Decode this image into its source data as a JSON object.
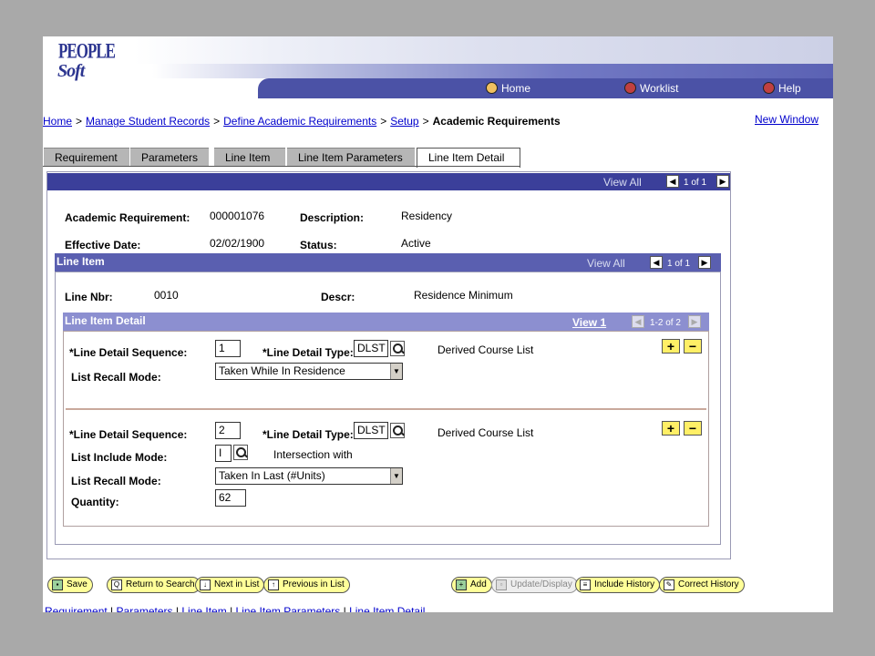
{
  "header": {
    "logo_line1": "PEOPLE",
    "logo_line2": "Soft",
    "nav": {
      "home": "Home",
      "worklist": "Worklist",
      "help": "Help"
    }
  },
  "breadcrumb": {
    "items": [
      "Home",
      "Manage Student Records",
      "Define Academic Requirements",
      "Setup"
    ],
    "separator": ">",
    "current": "Academic Requirements"
  },
  "new_window": "New Window",
  "tabs": [
    "Requirement",
    "Parameters",
    "Line Item",
    "Line Item Parameters",
    "Line Item Detail"
  ],
  "main": {
    "view_all": "View All",
    "counter": "1 of 1",
    "fields": {
      "academic_requirement_label": "Academic Requirement:",
      "academic_requirement_value": "000001076",
      "description_label": "Description:",
      "description_value": "Residency",
      "effective_date_label": "Effective Date:",
      "effective_date_value": "02/02/1900",
      "status_label": "Status:",
      "status_value": "Active"
    }
  },
  "line_item": {
    "title": "Line Item",
    "view_all": "View All",
    "counter": "1 of 1",
    "line_nbr_label": "Line Nbr:",
    "line_nbr_value": "0010",
    "descr_label": "Descr:",
    "descr_value": "Residence Minimum"
  },
  "line_item_detail": {
    "title": "Line Item Detail",
    "view_link": "View 1",
    "counter": "1-2 of 2",
    "rows": [
      {
        "seq_label": "*Line Detail Sequence:",
        "seq_value": "1",
        "type_label": "*Line Detail Type:",
        "type_value": "DLST",
        "type_desc": "Derived Course List",
        "recall_label": "List Recall Mode:",
        "recall_value": "Taken While In Residence"
      },
      {
        "seq_label": "*Line Detail Sequence:",
        "seq_value": "2",
        "type_label": "*Line Detail Type:",
        "type_value": "DLST",
        "type_desc": "Derived Course List",
        "include_label": "List Include Mode:",
        "include_value": "I",
        "include_desc": "Intersection with",
        "recall_label": "List Recall Mode:",
        "recall_value": "Taken In Last (#Units)",
        "quantity_label": "Quantity:",
        "quantity_value": "62"
      }
    ],
    "add_symbol": "+",
    "remove_symbol": "−"
  },
  "toolbar": {
    "save": "Save",
    "return_to_search": "Return to Search",
    "next_in_list": "Next in List",
    "previous_in_list": "Previous in List",
    "add": "Add",
    "update_display": "Update/Display",
    "include_history": "Include History",
    "correct_history": "Correct History"
  },
  "bottom_links": [
    "Requirement",
    "Parameters",
    "Line Item",
    "Line Item Parameters",
    "Line Item Detail"
  ],
  "bottom_separator": "|",
  "icons": {
    "home": "home-icon",
    "worklist": "worklist-icon",
    "help": "help-icon",
    "lookup": "magnifier-icon",
    "dropdown": "dropdown-arrow-icon",
    "prev": "prev-arrow-icon",
    "next": "next-arrow-icon"
  },
  "colors": {
    "nav_bar": "#4b52a6",
    "section_dark": "#3b3f9a",
    "section_mid": "#5a5fb0",
    "section_light": "#8c8fd0",
    "button_yellow": "#ffff99",
    "link": "#0000cc"
  }
}
